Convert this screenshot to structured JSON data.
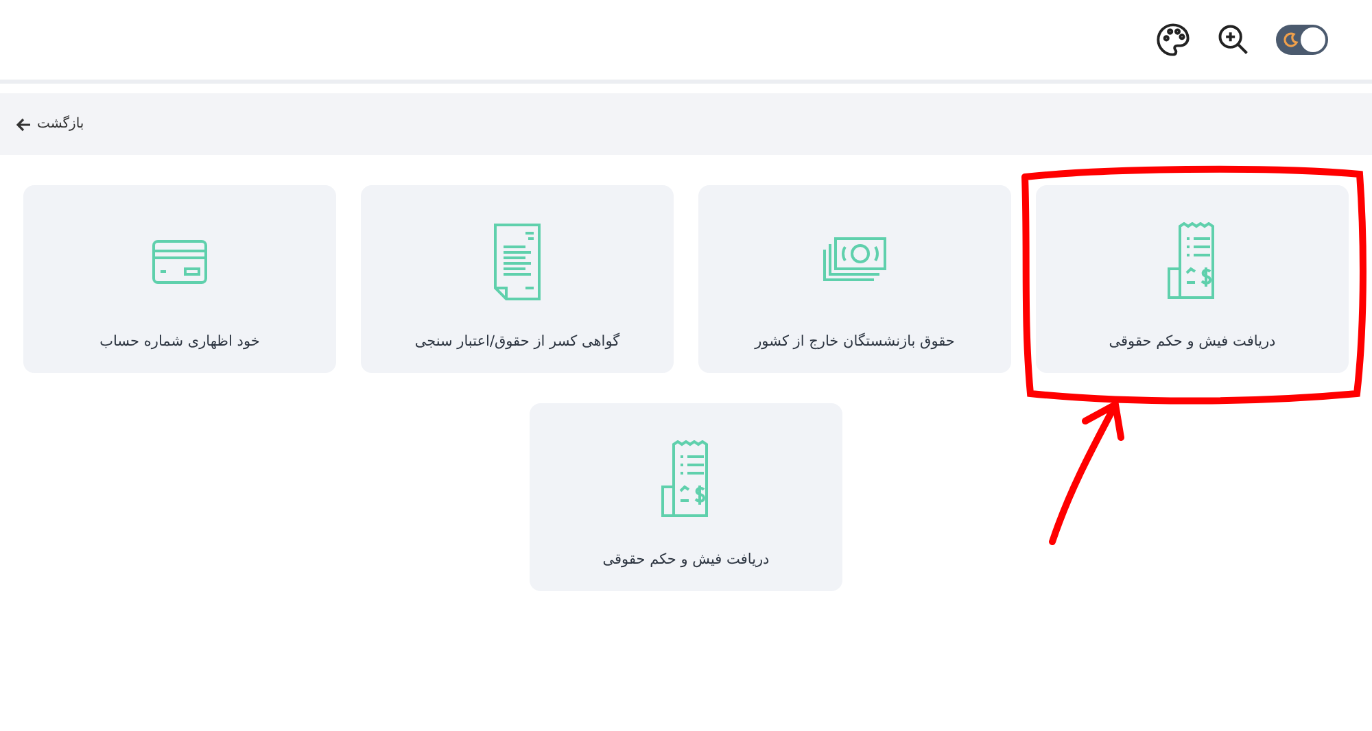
{
  "header": {
    "theme_toggle": {
      "on": true
    }
  },
  "back_bar": {
    "label": "بازگشت"
  },
  "cards": [
    {
      "kind": "receipt",
      "label": "دریافت فیش و حکم حقوقی",
      "annotated": true
    },
    {
      "kind": "cash",
      "label": "حقوق بازنشستگان خارج از کشور"
    },
    {
      "kind": "document",
      "label": "گواهی کسر از حقوق/اعتبار سنجی"
    },
    {
      "kind": "card",
      "label": "خود اظهاری شماره حساب"
    },
    {
      "kind": "receipt",
      "label": "دریافت فیش و حکم حقوقی"
    }
  ]
}
